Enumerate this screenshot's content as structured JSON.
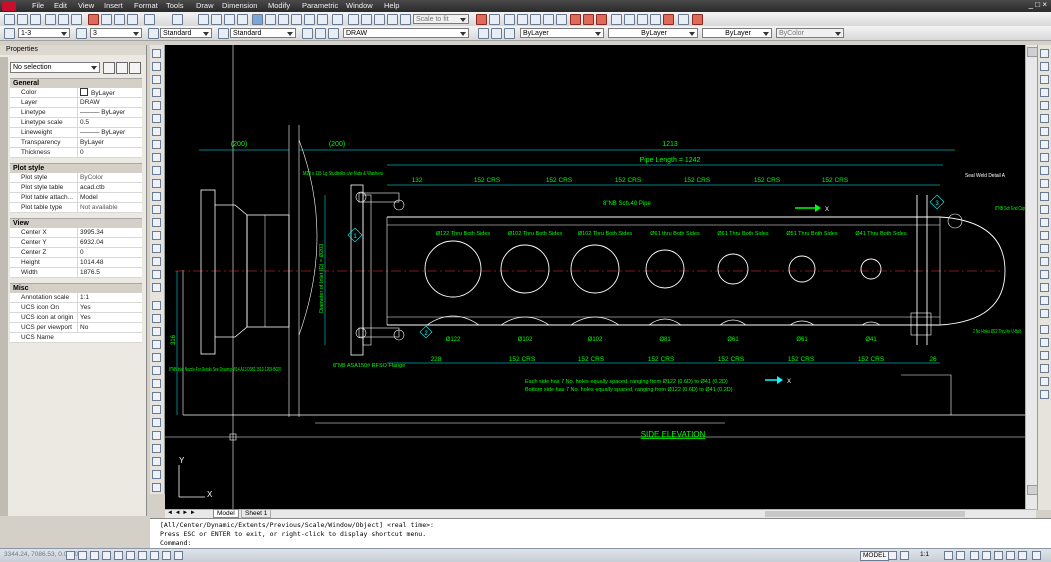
{
  "menubar": {
    "items": [
      "File",
      "Edit",
      "View",
      "Insert",
      "Format",
      "Tools",
      "Draw",
      "Dimension",
      "Modify",
      "Parametric",
      "Window",
      "Help"
    ],
    "window_controls": "_ □ ×"
  },
  "toolbar": {
    "scale_combo": "Scale to fit",
    "layer_state": "1-3",
    "layer_number": "3",
    "text_style": "Standard",
    "dim_style": "Standard",
    "layer_name": "DRAW",
    "color": "ByLayer",
    "linetype": "ByLayer",
    "lineweight": "ByLayer",
    "plotstyle": "ByColor"
  },
  "properties": {
    "title": "Properties",
    "selection": "No selection",
    "sections": [
      {
        "name": "General",
        "rows": [
          {
            "k": "Color",
            "v": "ByLayer"
          },
          {
            "k": "Layer",
            "v": "DRAW"
          },
          {
            "k": "Linetype",
            "v": "——— ByLayer"
          },
          {
            "k": "Linetype scale",
            "v": "0.5"
          },
          {
            "k": "Lineweight",
            "v": "——— ByLayer"
          },
          {
            "k": "Transparency",
            "v": "ByLayer"
          },
          {
            "k": "Thickness",
            "v": "0"
          }
        ]
      },
      {
        "name": "Plot style",
        "rows": [
          {
            "k": "Plot style",
            "v": "ByColor"
          },
          {
            "k": "Plot style table",
            "v": "acad.ctb"
          },
          {
            "k": "Plot table attach…",
            "v": "Model"
          },
          {
            "k": "Plot table type",
            "v": "Not available"
          }
        ]
      },
      {
        "name": "View",
        "rows": [
          {
            "k": "Center X",
            "v": "3995.34"
          },
          {
            "k": "Center Y",
            "v": "6932.04"
          },
          {
            "k": "Center Z",
            "v": "0"
          },
          {
            "k": "Height",
            "v": "1014.48"
          },
          {
            "k": "Width",
            "v": "1876.5"
          }
        ]
      },
      {
        "name": "Misc",
        "rows": [
          {
            "k": "Annotation scale",
            "v": "1:1"
          },
          {
            "k": "UCS icon On",
            "v": "Yes"
          },
          {
            "k": "UCS icon at origin",
            "v": "Yes"
          },
          {
            "k": "UCS per viewport",
            "v": "No"
          },
          {
            "k": "UCS Name",
            "v": ""
          }
        ]
      }
    ]
  },
  "drawing": {
    "dim_200a": "(200)",
    "dim_200b": "(200)",
    "dim_1213": "1213",
    "pipe_length": "Pipe Length = 1242",
    "top_dims": [
      "132",
      "152 CRS",
      "152 CRS",
      "152 CRS",
      "152 CRS",
      "152 CRS",
      "152 CRS"
    ],
    "bottom_dims": [
      "228",
      "152 CRS",
      "152 CRS",
      "152 CRS",
      "152 CRS",
      "152 CRS",
      "152 CRS",
      "26"
    ],
    "studbolts": "M20 x 115 Lg Studbolts c/w Nuts & Washers",
    "pipe_label": "8\"NB Sch.40 Pipe",
    "hole_labels": [
      "Ø122 Thru Both Sides",
      "Ø102 Thru Both Sides",
      "Ø102 Thru Both Sides",
      "Ø61 thru Both Sides",
      "Ø61 Thru Both Sides",
      "Ø51 Thru Both Sides",
      "Ø41 Thru Both Sides"
    ],
    "bottom_holes": [
      "Ø122",
      "Ø102",
      "Ø102",
      "Ø81",
      "Ø61",
      "Ø61",
      "Ø41"
    ],
    "diameter_label": "Diameter of Inlet (D) = Ø203",
    "inlet_nozzle": "8\"NB Inlet Nozzle For Details See Drawing W14.A13.D082.1513-1269-B020",
    "flange": "8\"NB ASA150# RFSO Flange",
    "seal_weld": "Seal Weld Detail A",
    "end_cap": "8\"NB Sch End Cap",
    "ubolt": "2 No Holes Ø22 Thru for U-Bolt",
    "note1": "Each side has 7 No. holes equally spaced, ranging from Ø122 (0.6D) to Ø41 (0.2D)",
    "note2": "Bottom side has 7 No. holes equally spaced, ranging from Ø122 (0.6D) to Ø41 (0.2D)",
    "side_elevation": "SIDE ELEVATION",
    "dim_316": "316",
    "x_label": "X",
    "y_label": "Y",
    "tag_1": "1",
    "tag_2": "2",
    "tag_3": "3"
  },
  "tabs": {
    "model": "Model",
    "sheet": "Sheet 1"
  },
  "command": {
    "line1": "[All/Center/Dynamic/Extents/Previous/Scale/Window/Object] <real time>:",
    "line2": "Press ESC or ENTER to exit, or right-click to display shortcut menu.",
    "prompt": "Command:"
  },
  "status": {
    "coords": "3344.24, 7086.53, 0.0000",
    "model": "MODEL",
    "scale": "1:1"
  },
  "colors": {
    "accent_green": "#00ff00",
    "accent_cyan": "#00ffff",
    "accent_red": "#ff3333",
    "canvas_bg": "#000000",
    "drawing_white": "#ffffff",
    "drawing_yellow": "#ffff00"
  }
}
